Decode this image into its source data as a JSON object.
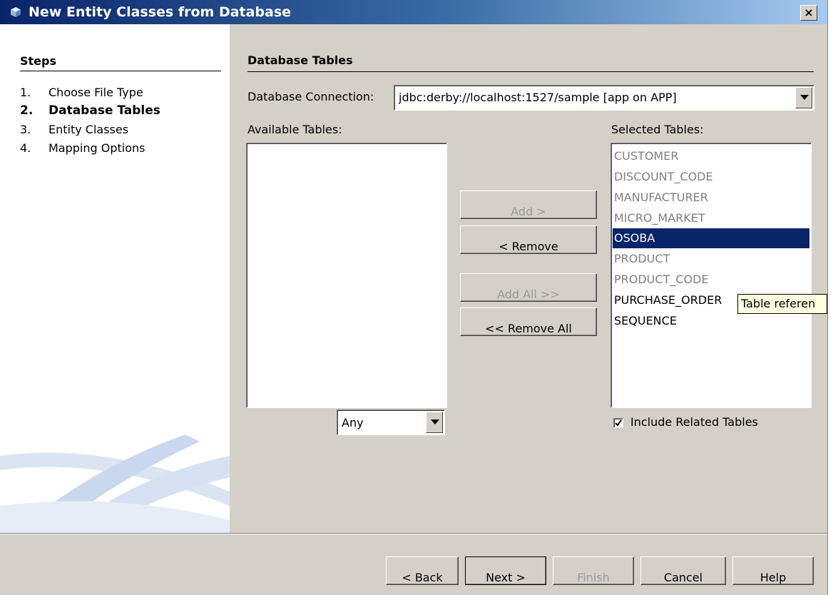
{
  "window": {
    "title": "New Entity Classes from Database",
    "close_label": "×"
  },
  "steps": {
    "title": "Steps",
    "items": [
      {
        "num": "1.",
        "label": "Choose File Type"
      },
      {
        "num": "2.",
        "label": "Database Tables"
      },
      {
        "num": "3.",
        "label": "Entity Classes"
      },
      {
        "num": "4.",
        "label": "Mapping Options"
      }
    ],
    "active_index": 1
  },
  "panel": {
    "title": "Database Tables",
    "connection_label": "Database Connection:",
    "connection_value": "jdbc:derby://localhost:1527/sample [app on APP]",
    "available_label": "Available Tables:",
    "selected_label": "Selected Tables:",
    "filter_value": "Any",
    "include_related_label": "Include Related Tables",
    "include_related_checked": true
  },
  "selected_tables": [
    {
      "name": "CUSTOMER",
      "enabled": false
    },
    {
      "name": "DISCOUNT_CODE",
      "enabled": false
    },
    {
      "name": "MANUFACTURER",
      "enabled": false
    },
    {
      "name": "MICRO_MARKET",
      "enabled": false
    },
    {
      "name": "OSOBA",
      "enabled": true,
      "selected": true
    },
    {
      "name": "PRODUCT",
      "enabled": false
    },
    {
      "name": "PRODUCT_CODE",
      "enabled": false
    },
    {
      "name": "PURCHASE_ORDER",
      "enabled": true
    },
    {
      "name": "SEQUENCE",
      "enabled": true
    }
  ],
  "transfer_buttons": {
    "add": "Add >",
    "remove": "< Remove",
    "add_all": "Add All >>",
    "remove_all": "<< Remove All"
  },
  "tooltip": "Table referen",
  "footer": {
    "back": "< Back",
    "next": "Next >",
    "finish": "Finish",
    "cancel": "Cancel",
    "help": "Help"
  },
  "colors": {
    "dialog_bg": "#d4d0c8",
    "selection": "#0a246a",
    "tooltip_bg": "#ffffe1"
  }
}
